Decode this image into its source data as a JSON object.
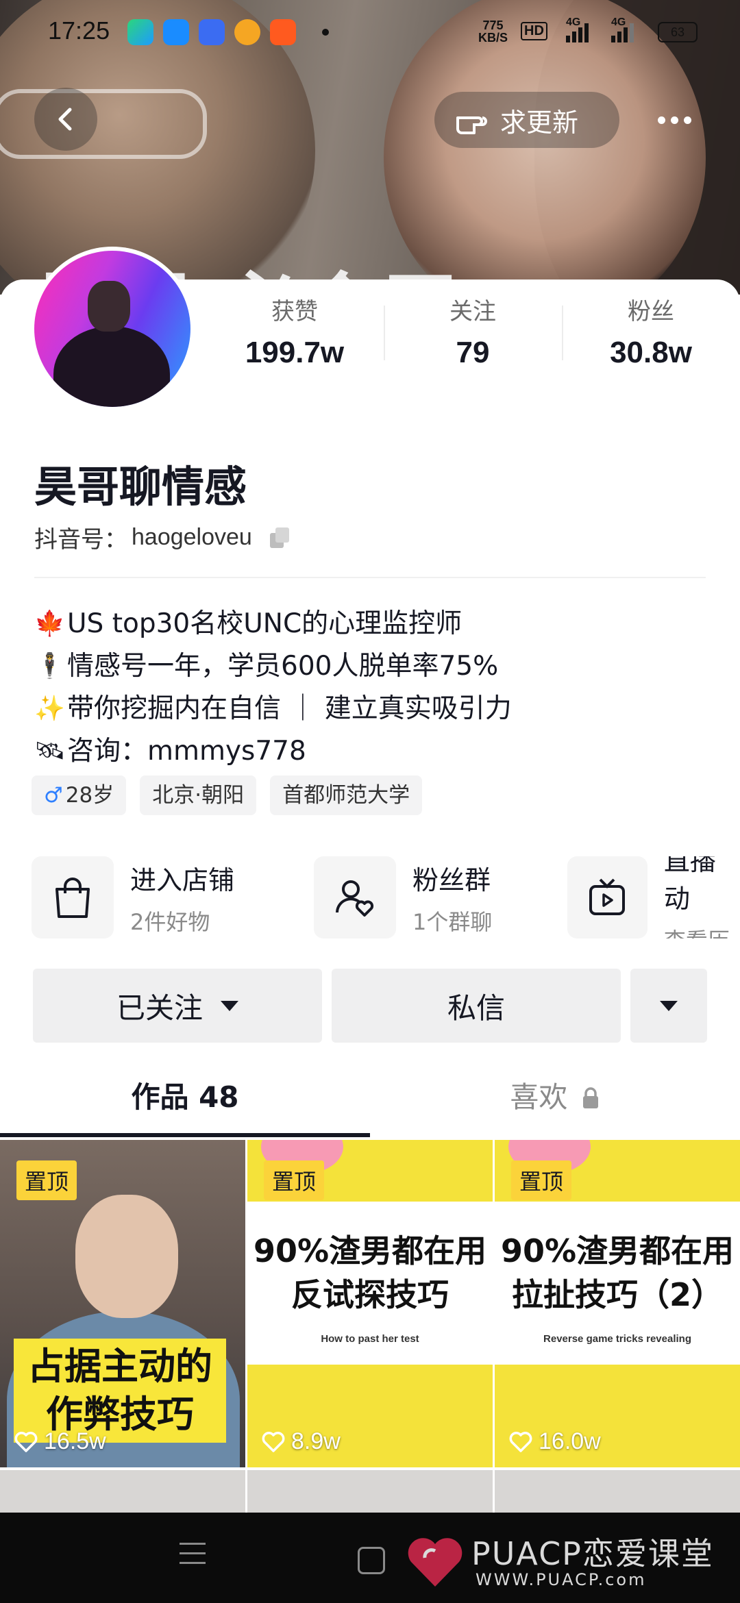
{
  "status_bar": {
    "time": "17:25",
    "net_speed_value": "775",
    "net_speed_unit": "KB/S",
    "hd_badge": "HD",
    "sim1": "4G",
    "sim2": "4G",
    "battery": "63"
  },
  "banner": {
    "overlay_text": "昊哥 必会干"
  },
  "header": {
    "request_update_label": "求更新"
  },
  "profile": {
    "nickname": "昊哥聊情感",
    "douyin_id_label": "抖音号：",
    "douyin_id": "haogeloveu",
    "stats": [
      {
        "label": "获赞",
        "value": "199.7w"
      },
      {
        "label": "关注",
        "value": "79"
      },
      {
        "label": "粉丝",
        "value": "30.8w"
      }
    ],
    "bio": [
      {
        "emoji": "🍁",
        "text": "US top30名校UNC的心理监控师"
      },
      {
        "emoji": "🕴",
        "text": "情感号一年，学员600人脱单率75%"
      },
      {
        "emoji": "✨",
        "text": "带你挖掘内在自信 ｜ 建立真实吸引力"
      },
      {
        "emoji": "🛰",
        "text": "咨询：mmmys778"
      }
    ],
    "tags": {
      "gender_symbol": "♂",
      "age": "28岁",
      "location": "北京·朝阳",
      "school": "首都师范大学"
    }
  },
  "shortcuts": [
    {
      "title": "进入店铺",
      "subtitle": "2件好物",
      "icon": "bag-icon"
    },
    {
      "title": "粉丝群",
      "subtitle": "1个群聊",
      "icon": "fans-group-icon"
    },
    {
      "title": "直播动",
      "subtitle": "查看历",
      "icon": "tv-play-icon"
    }
  ],
  "actions": {
    "followed_label": "已关注",
    "message_label": "私信"
  },
  "tabs": {
    "works_label": "作品 48",
    "likes_label": "喜欢"
  },
  "videos": [
    {
      "pinned": "置顶",
      "caption": "占据主动的\n作弊技巧",
      "likes": "16.5w"
    },
    {
      "pinned": "置顶",
      "caption": "90%渣男都在用\n反试探技巧",
      "subtitle": "How to past her test",
      "likes": "8.9w"
    },
    {
      "pinned": "置顶",
      "caption": "90%渣男都在用\n拉扯技巧（2）",
      "subtitle": "Reverse game tricks revealing",
      "likes": "16.0w"
    }
  ],
  "watermark": {
    "title": "PUACP恋爱课堂",
    "url": "WWW.PUACP.com"
  }
}
